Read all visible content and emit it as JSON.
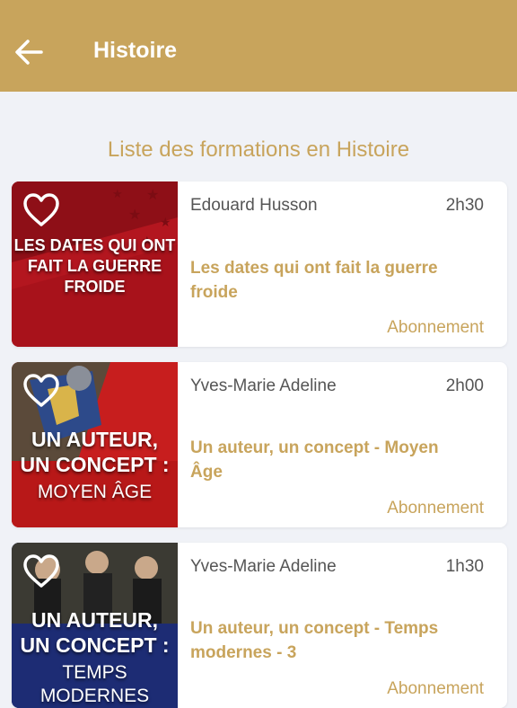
{
  "header": {
    "title": "Histoire"
  },
  "section": {
    "title": "Liste des formations en Histoire"
  },
  "cards": [
    {
      "thumb_text": "LES DATES QUI ONT FAIT LA GUERRE FROIDE",
      "author": "Edouard Husson",
      "duration": "2h30",
      "course_title": "Les dates qui ont fait la guerre froide",
      "badge": "Abonnement"
    },
    {
      "thumb_line1": "UN AUTEUR,",
      "thumb_line2": "UN CONCEPT :",
      "thumb_sub": "MOYEN ÂGE",
      "author": "Yves-Marie Adeline",
      "duration": "2h00",
      "course_title": "Un auteur, un concept - Moyen Âge",
      "badge": "Abonnement"
    },
    {
      "thumb_line1": "UN AUTEUR,",
      "thumb_line2": "UN CONCEPT :",
      "thumb_sub": "TEMPS MODERNES",
      "author": "Yves-Marie Adeline",
      "duration": "1h30",
      "course_title": "Un auteur, un concept - Temps modernes - 3",
      "badge": "Abonnement"
    }
  ],
  "colors": {
    "accent": "#c8a45c",
    "background": "#f0f2f7"
  }
}
